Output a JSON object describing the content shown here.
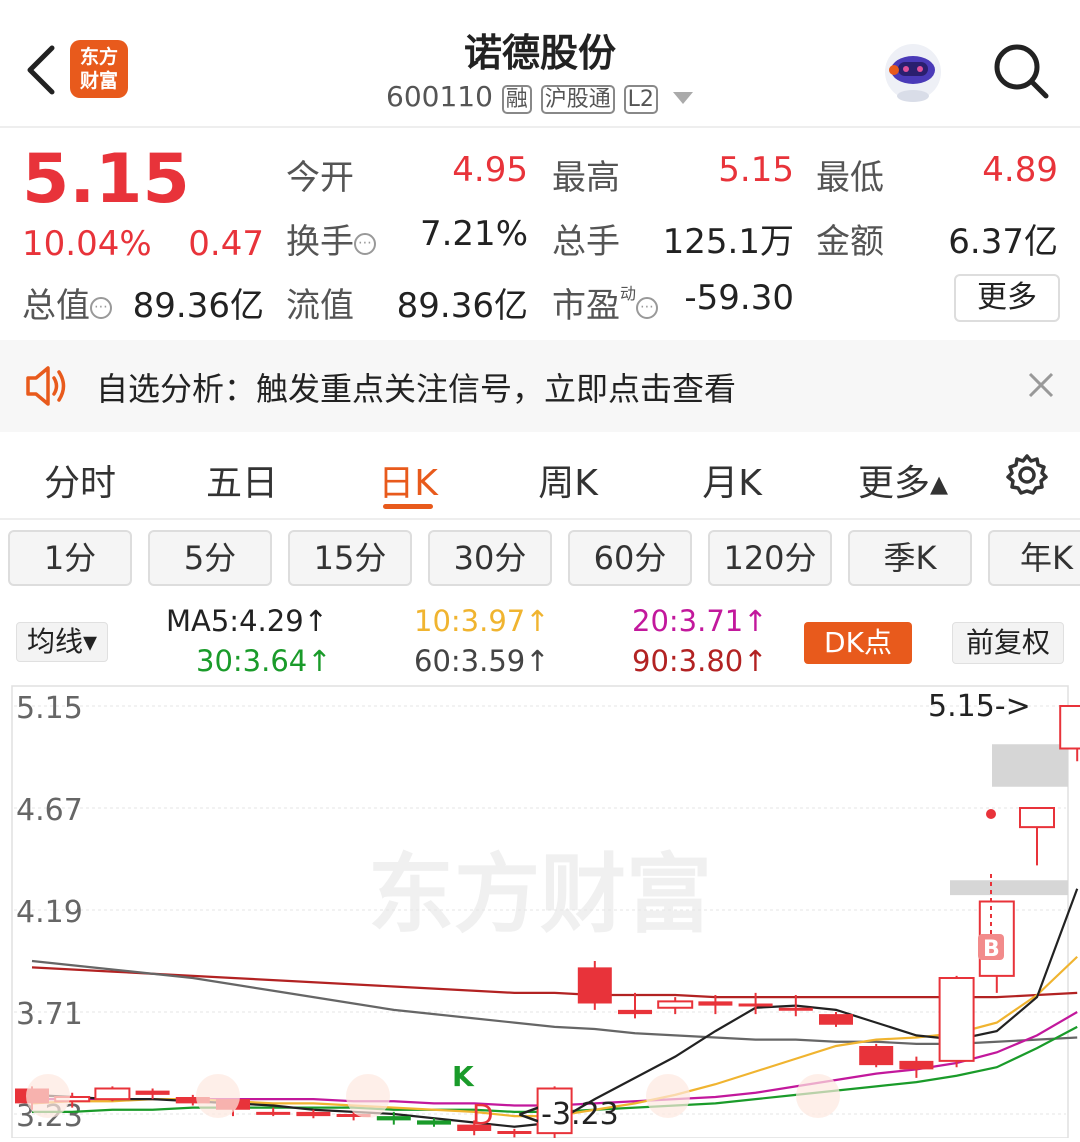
{
  "header": {
    "title": "诺德股份",
    "code": "600110",
    "tags": [
      "融",
      "沪股通",
      "L2"
    ],
    "logo_lines": [
      "东方",
      "财富"
    ]
  },
  "quote": {
    "price": "5.15",
    "change_pct": "10.04%",
    "change_amt": "0.47",
    "fields": {
      "open_label": "今开",
      "open": "4.95",
      "high_label": "最高",
      "high": "5.15",
      "low_label": "最低",
      "low": "4.89",
      "turnover_label": "换手",
      "turnover": "7.21%",
      "volume_label": "总手",
      "volume": "125.1万",
      "amount_label": "金额",
      "amount": "6.37亿",
      "mktcap_label": "总值",
      "mktcap": "89.36亿",
      "float_label": "流值",
      "float": "89.36亿",
      "pe_label": "市盈",
      "pe_sup": "动",
      "pe": "-59.30",
      "more": "更多"
    }
  },
  "alert": {
    "text": "自选分析：触发重点关注信号，立即点击查看"
  },
  "kline_tabs": [
    "分时",
    "五日",
    "日K",
    "周K",
    "月K",
    "更多▴"
  ],
  "active_tab": "日K",
  "periods": [
    "1分",
    "5分",
    "15分",
    "30分",
    "60分",
    "120分",
    "季K",
    "年K"
  ],
  "ma_bar": {
    "selector": "均线▾",
    "ma5": "MA5:4.29↑",
    "ma10": "10:3.97↑",
    "ma20": "20:3.71↑",
    "ma30": "30:3.64↑",
    "ma60": "60:3.59↑",
    "ma90": "90:3.80↑",
    "dk": "DK点",
    "adjust": "前复权"
  },
  "colors": {
    "up": "#e8333a",
    "down": "#1a9b2a",
    "brand": "#e85a1c",
    "ma5": "#222222",
    "ma10": "#f0b430",
    "ma20": "#c2189c",
    "ma30": "#1a9b2a",
    "ma60": "#666666",
    "ma90": "#b22222"
  },
  "chart_data": {
    "type": "candlestick",
    "y_ticks": [
      "5.15",
      "4.67",
      "4.19",
      "3.71",
      "3.23"
    ],
    "ylim": [
      3.23,
      5.15
    ],
    "watermark": "东方财富",
    "annotations": {
      "high_label": "5.15->",
      "low_label": "<-3.23",
      "k_mark": "K",
      "d_mark": "D",
      "b_mark": "B"
    },
    "candles": [
      {
        "o": 3.35,
        "c": 3.28,
        "h": 3.36,
        "l": 3.25
      },
      {
        "o": 3.29,
        "c": 3.31,
        "h": 3.33,
        "l": 3.26
      },
      {
        "o": 3.3,
        "c": 3.35,
        "h": 3.36,
        "l": 3.29
      },
      {
        "o": 3.34,
        "c": 3.32,
        "h": 3.35,
        "l": 3.3
      },
      {
        "o": 3.31,
        "c": 3.28,
        "h": 3.32,
        "l": 3.27
      },
      {
        "o": 3.3,
        "c": 3.25,
        "h": 3.3,
        "l": 3.22
      },
      {
        "o": 3.24,
        "c": 3.23,
        "h": 3.26,
        "l": 3.22
      },
      {
        "o": 3.24,
        "c": 3.22,
        "h": 3.25,
        "l": 3.21
      },
      {
        "o": 3.23,
        "c": 3.22,
        "h": 3.24,
        "l": 3.2
      },
      {
        "o": 3.22,
        "c": 3.2,
        "h": 3.24,
        "l": 3.18
      },
      {
        "o": 3.2,
        "c": 3.18,
        "h": 3.21,
        "l": 3.17
      },
      {
        "o": 3.18,
        "c": 3.15,
        "h": 3.2,
        "l": 3.13
      },
      {
        "o": 3.15,
        "c": 3.14,
        "h": 3.16,
        "l": 3.12
      },
      {
        "o": 3.14,
        "c": 3.35,
        "h": 3.36,
        "l": 3.1
      },
      {
        "o": 3.92,
        "c": 3.75,
        "h": 3.95,
        "l": 3.72
      },
      {
        "o": 3.72,
        "c": 3.7,
        "h": 3.8,
        "l": 3.68
      },
      {
        "o": 3.73,
        "c": 3.76,
        "h": 3.78,
        "l": 3.7
      },
      {
        "o": 3.76,
        "c": 3.74,
        "h": 3.79,
        "l": 3.7
      },
      {
        "o": 3.75,
        "c": 3.74,
        "h": 3.8,
        "l": 3.7
      },
      {
        "o": 3.73,
        "c": 3.72,
        "h": 3.79,
        "l": 3.69
      },
      {
        "o": 3.7,
        "c": 3.65,
        "h": 3.71,
        "l": 3.64
      },
      {
        "o": 3.55,
        "c": 3.46,
        "h": 3.56,
        "l": 3.45
      },
      {
        "o": 3.48,
        "c": 3.44,
        "h": 3.5,
        "l": 3.4
      },
      {
        "o": 3.48,
        "c": 3.87,
        "h": 3.88,
        "l": 3.45
      },
      {
        "o": 3.88,
        "c": 4.23,
        "h": 4.23,
        "l": 3.8
      },
      {
        "o": 4.58,
        "c": 4.67,
        "h": 4.67,
        "l": 4.4
      },
      {
        "o": 4.95,
        "c": 5.15,
        "h": 5.15,
        "l": 4.89
      }
    ],
    "ma_series": {
      "ma5": [
        3.32,
        3.31,
        3.3,
        3.3,
        3.29,
        3.28,
        3.27,
        3.25,
        3.24,
        3.23,
        3.21,
        3.19,
        3.17,
        3.19,
        3.3,
        3.4,
        3.5,
        3.62,
        3.73,
        3.74,
        3.72,
        3.66,
        3.6,
        3.58,
        3.62,
        3.78,
        4.29
      ],
      "ma10": [
        3.28,
        3.29,
        3.29,
        3.3,
        3.3,
        3.29,
        3.28,
        3.28,
        3.27,
        3.26,
        3.25,
        3.24,
        3.22,
        3.22,
        3.25,
        3.28,
        3.32,
        3.37,
        3.43,
        3.49,
        3.55,
        3.58,
        3.59,
        3.61,
        3.66,
        3.79,
        3.97
      ],
      "ma20": [
        3.3,
        3.3,
        3.3,
        3.3,
        3.3,
        3.3,
        3.3,
        3.3,
        3.29,
        3.29,
        3.28,
        3.28,
        3.27,
        3.27,
        3.28,
        3.29,
        3.3,
        3.31,
        3.33,
        3.36,
        3.39,
        3.42,
        3.44,
        3.47,
        3.52,
        3.6,
        3.71
      ],
      "ma30": [
        3.24,
        3.24,
        3.25,
        3.25,
        3.26,
        3.26,
        3.26,
        3.26,
        3.26,
        3.25,
        3.25,
        3.25,
        3.24,
        3.24,
        3.25,
        3.26,
        3.27,
        3.28,
        3.3,
        3.32,
        3.34,
        3.36,
        3.38,
        3.41,
        3.45,
        3.54,
        3.64
      ],
      "ma60": [
        3.95,
        3.93,
        3.91,
        3.89,
        3.87,
        3.84,
        3.81,
        3.78,
        3.75,
        3.72,
        3.7,
        3.68,
        3.66,
        3.64,
        3.63,
        3.61,
        3.6,
        3.59,
        3.58,
        3.58,
        3.57,
        3.57,
        3.56,
        3.56,
        3.57,
        3.58,
        3.59
      ],
      "ma90": [
        3.92,
        3.91,
        3.9,
        3.89,
        3.88,
        3.87,
        3.86,
        3.85,
        3.84,
        3.83,
        3.82,
        3.81,
        3.8,
        3.8,
        3.79,
        3.79,
        3.79,
        3.78,
        3.78,
        3.78,
        3.78,
        3.78,
        3.78,
        3.78,
        3.78,
        3.79,
        3.8
      ]
    },
    "grid": true
  }
}
